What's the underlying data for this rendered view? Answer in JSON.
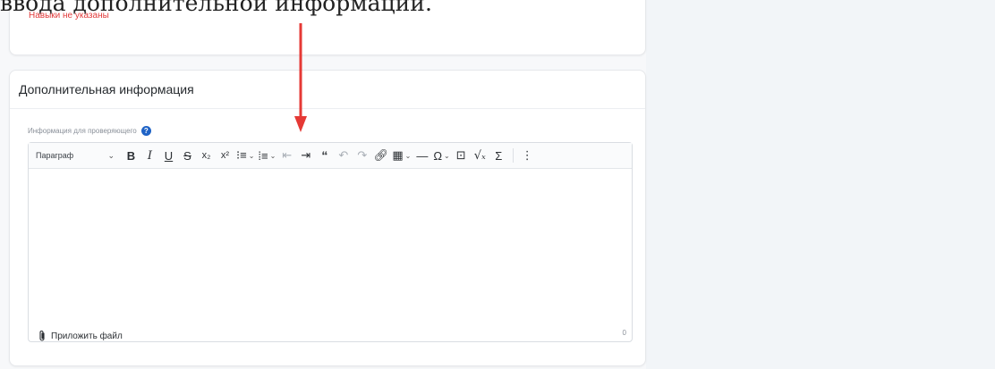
{
  "caption": "ввода дополнительной информации.",
  "skills": {
    "empty_text": "Навыки не указаны"
  },
  "section": {
    "title": "Дополнительная информация",
    "field_label": "Информация для проверяющего",
    "help_icon": "question-circle-icon"
  },
  "editor": {
    "paragraph_label": "Параграф",
    "char_count": "0",
    "toolbar_icons": [
      "bold",
      "italic",
      "underline",
      "strikethrough",
      "subscript",
      "superscript",
      "numbered-list",
      "bulleted-list",
      "outdent",
      "indent",
      "blockquote",
      "undo",
      "redo",
      "link",
      "table",
      "horizontal-line",
      "special-characters",
      "media",
      "math-formula",
      "sum",
      "more"
    ]
  },
  "attach": {
    "label": "Приложить файл",
    "icon": "paperclip-icon"
  },
  "colors": {
    "accent_blue": "#1f63c6",
    "error_red": "#e23b3b",
    "arrow_red": "#e53935",
    "right_panel": "#f2f5f8"
  }
}
